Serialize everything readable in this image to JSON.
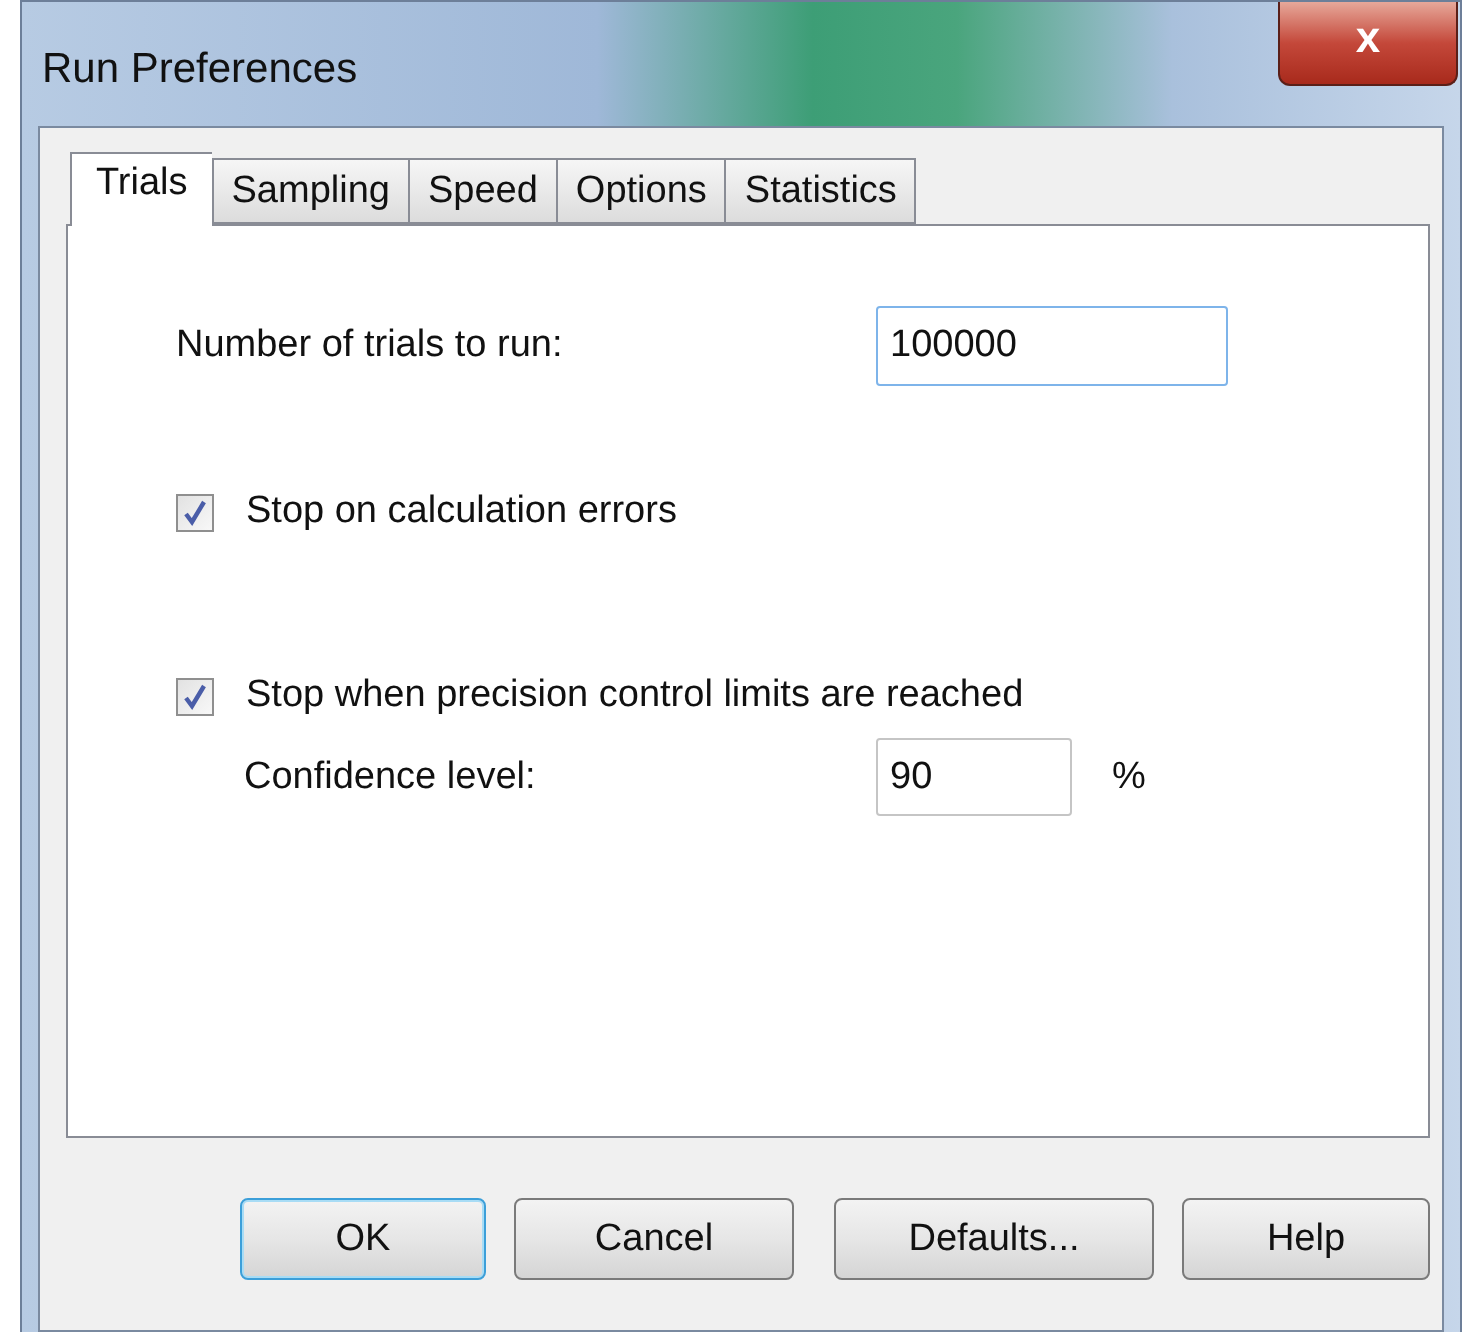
{
  "window": {
    "title": "Run Preferences",
    "close": "x"
  },
  "tabs": [
    {
      "label": "Trials",
      "selected": true
    },
    {
      "label": "Sampling",
      "selected": false
    },
    {
      "label": "Speed",
      "selected": false
    },
    {
      "label": "Options",
      "selected": false
    },
    {
      "label": "Statistics",
      "selected": false
    }
  ],
  "trials": {
    "label": "Number of trials to run:",
    "value": "100000"
  },
  "checks": [
    {
      "label": "Stop on calculation errors",
      "checked": true
    },
    {
      "label": "Stop when precision control limits are reached",
      "checked": true
    }
  ],
  "confidence": {
    "label": "Confidence level:",
    "value": "90",
    "unit": "%"
  },
  "buttons": [
    {
      "label": "OK",
      "selected": true
    },
    {
      "label": "Cancel",
      "selected": false
    },
    {
      "label": "Defaults...",
      "selected": false
    },
    {
      "label": "Help",
      "selected": false
    }
  ]
}
